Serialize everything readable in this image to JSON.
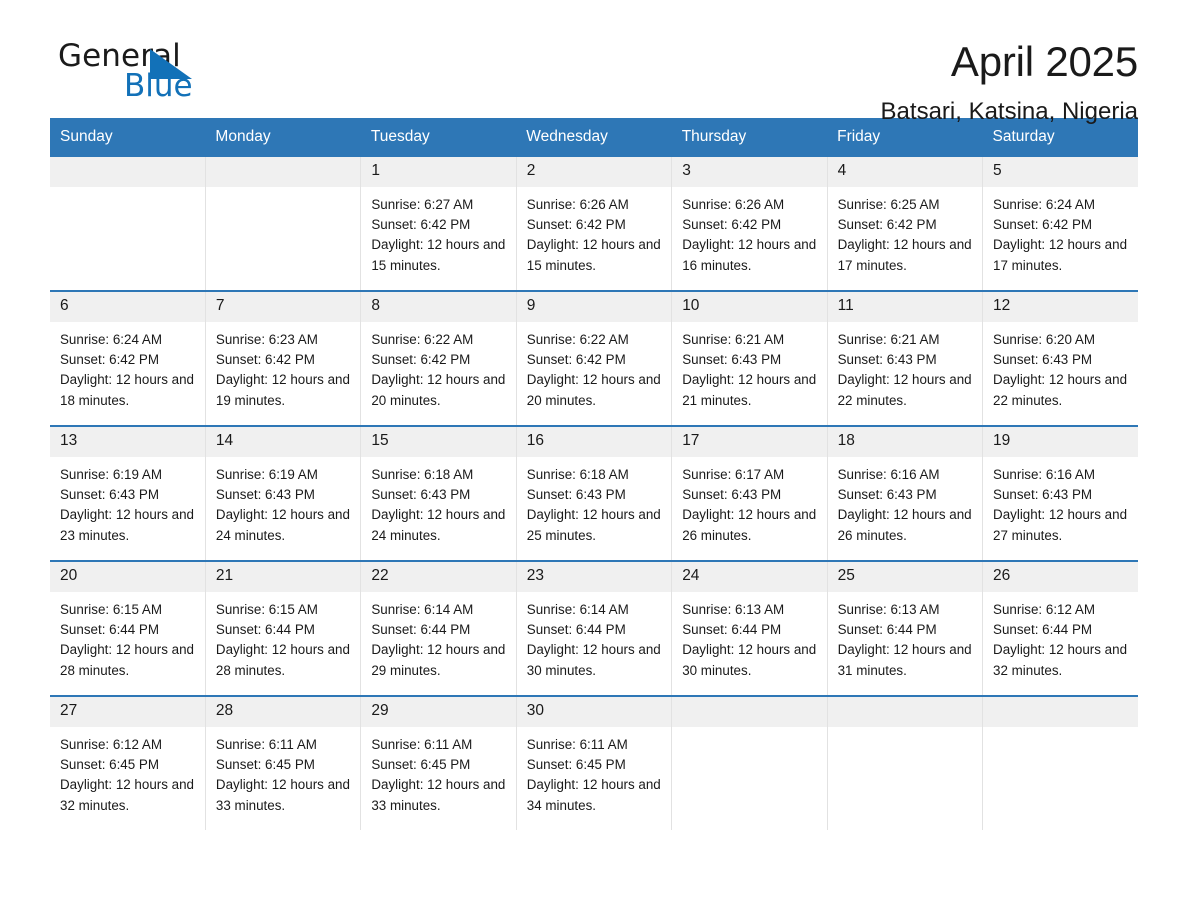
{
  "brand": {
    "name_part1": "General",
    "name_part2": "Blue",
    "logo_icon": "triangle-logo-icon",
    "accent_color": "#1271b8"
  },
  "header": {
    "month_title": "April 2025",
    "location": "Batsari, Katsina, Nigeria"
  },
  "calendar": {
    "header_bg_color": "#2e77b6",
    "daynum_bg_color": "#f0f0f0",
    "weekday_headers": [
      "Sunday",
      "Monday",
      "Tuesday",
      "Wednesday",
      "Thursday",
      "Friday",
      "Saturday"
    ],
    "weeks": [
      [
        {
          "day": "",
          "sunrise": "",
          "sunset": "",
          "daylight": "",
          "blank": true
        },
        {
          "day": "",
          "sunrise": "",
          "sunset": "",
          "daylight": "",
          "blank": true
        },
        {
          "day": "1",
          "sunrise": "Sunrise: 6:27 AM",
          "sunset": "Sunset: 6:42 PM",
          "daylight": "Daylight: 12 hours and 15 minutes."
        },
        {
          "day": "2",
          "sunrise": "Sunrise: 6:26 AM",
          "sunset": "Sunset: 6:42 PM",
          "daylight": "Daylight: 12 hours and 15 minutes."
        },
        {
          "day": "3",
          "sunrise": "Sunrise: 6:26 AM",
          "sunset": "Sunset: 6:42 PM",
          "daylight": "Daylight: 12 hours and 16 minutes."
        },
        {
          "day": "4",
          "sunrise": "Sunrise: 6:25 AM",
          "sunset": "Sunset: 6:42 PM",
          "daylight": "Daylight: 12 hours and 17 minutes."
        },
        {
          "day": "5",
          "sunrise": "Sunrise: 6:24 AM",
          "sunset": "Sunset: 6:42 PM",
          "daylight": "Daylight: 12 hours and 17 minutes."
        }
      ],
      [
        {
          "day": "6",
          "sunrise": "Sunrise: 6:24 AM",
          "sunset": "Sunset: 6:42 PM",
          "daylight": "Daylight: 12 hours and 18 minutes."
        },
        {
          "day": "7",
          "sunrise": "Sunrise: 6:23 AM",
          "sunset": "Sunset: 6:42 PM",
          "daylight": "Daylight: 12 hours and 19 minutes."
        },
        {
          "day": "8",
          "sunrise": "Sunrise: 6:22 AM",
          "sunset": "Sunset: 6:42 PM",
          "daylight": "Daylight: 12 hours and 20 minutes."
        },
        {
          "day": "9",
          "sunrise": "Sunrise: 6:22 AM",
          "sunset": "Sunset: 6:42 PM",
          "daylight": "Daylight: 12 hours and 20 minutes."
        },
        {
          "day": "10",
          "sunrise": "Sunrise: 6:21 AM",
          "sunset": "Sunset: 6:43 PM",
          "daylight": "Daylight: 12 hours and 21 minutes."
        },
        {
          "day": "11",
          "sunrise": "Sunrise: 6:21 AM",
          "sunset": "Sunset: 6:43 PM",
          "daylight": "Daylight: 12 hours and 22 minutes."
        },
        {
          "day": "12",
          "sunrise": "Sunrise: 6:20 AM",
          "sunset": "Sunset: 6:43 PM",
          "daylight": "Daylight: 12 hours and 22 minutes."
        }
      ],
      [
        {
          "day": "13",
          "sunrise": "Sunrise: 6:19 AM",
          "sunset": "Sunset: 6:43 PM",
          "daylight": "Daylight: 12 hours and 23 minutes."
        },
        {
          "day": "14",
          "sunrise": "Sunrise: 6:19 AM",
          "sunset": "Sunset: 6:43 PM",
          "daylight": "Daylight: 12 hours and 24 minutes."
        },
        {
          "day": "15",
          "sunrise": "Sunrise: 6:18 AM",
          "sunset": "Sunset: 6:43 PM",
          "daylight": "Daylight: 12 hours and 24 minutes."
        },
        {
          "day": "16",
          "sunrise": "Sunrise: 6:18 AM",
          "sunset": "Sunset: 6:43 PM",
          "daylight": "Daylight: 12 hours and 25 minutes."
        },
        {
          "day": "17",
          "sunrise": "Sunrise: 6:17 AM",
          "sunset": "Sunset: 6:43 PM",
          "daylight": "Daylight: 12 hours and 26 minutes."
        },
        {
          "day": "18",
          "sunrise": "Sunrise: 6:16 AM",
          "sunset": "Sunset: 6:43 PM",
          "daylight": "Daylight: 12 hours and 26 minutes."
        },
        {
          "day": "19",
          "sunrise": "Sunrise: 6:16 AM",
          "sunset": "Sunset: 6:43 PM",
          "daylight": "Daylight: 12 hours and 27 minutes."
        }
      ],
      [
        {
          "day": "20",
          "sunrise": "Sunrise: 6:15 AM",
          "sunset": "Sunset: 6:44 PM",
          "daylight": "Daylight: 12 hours and 28 minutes."
        },
        {
          "day": "21",
          "sunrise": "Sunrise: 6:15 AM",
          "sunset": "Sunset: 6:44 PM",
          "daylight": "Daylight: 12 hours and 28 minutes."
        },
        {
          "day": "22",
          "sunrise": "Sunrise: 6:14 AM",
          "sunset": "Sunset: 6:44 PM",
          "daylight": "Daylight: 12 hours and 29 minutes."
        },
        {
          "day": "23",
          "sunrise": "Sunrise: 6:14 AM",
          "sunset": "Sunset: 6:44 PM",
          "daylight": "Daylight: 12 hours and 30 minutes."
        },
        {
          "day": "24",
          "sunrise": "Sunrise: 6:13 AM",
          "sunset": "Sunset: 6:44 PM",
          "daylight": "Daylight: 12 hours and 30 minutes."
        },
        {
          "day": "25",
          "sunrise": "Sunrise: 6:13 AM",
          "sunset": "Sunset: 6:44 PM",
          "daylight": "Daylight: 12 hours and 31 minutes."
        },
        {
          "day": "26",
          "sunrise": "Sunrise: 6:12 AM",
          "sunset": "Sunset: 6:44 PM",
          "daylight": "Daylight: 12 hours and 32 minutes."
        }
      ],
      [
        {
          "day": "27",
          "sunrise": "Sunrise: 6:12 AM",
          "sunset": "Sunset: 6:45 PM",
          "daylight": "Daylight: 12 hours and 32 minutes."
        },
        {
          "day": "28",
          "sunrise": "Sunrise: 6:11 AM",
          "sunset": "Sunset: 6:45 PM",
          "daylight": "Daylight: 12 hours and 33 minutes."
        },
        {
          "day": "29",
          "sunrise": "Sunrise: 6:11 AM",
          "sunset": "Sunset: 6:45 PM",
          "daylight": "Daylight: 12 hours and 33 minutes."
        },
        {
          "day": "30",
          "sunrise": "Sunrise: 6:11 AM",
          "sunset": "Sunset: 6:45 PM",
          "daylight": "Daylight: 12 hours and 34 minutes."
        },
        {
          "day": "",
          "sunrise": "",
          "sunset": "",
          "daylight": "",
          "blank": true
        },
        {
          "day": "",
          "sunrise": "",
          "sunset": "",
          "daylight": "",
          "blank": true
        },
        {
          "day": "",
          "sunrise": "",
          "sunset": "",
          "daylight": "",
          "blank": true
        }
      ]
    ]
  }
}
